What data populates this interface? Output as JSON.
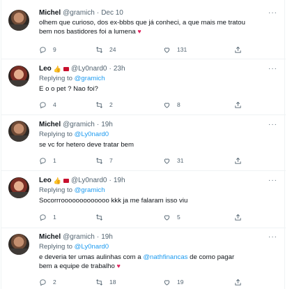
{
  "tweets": [
    {
      "author": "Michel",
      "handle": "@gramich",
      "time": "Dec 10",
      "reply_prefix": "",
      "reply_to": "",
      "text_html_parts": [
        {
          "t": "olhem que curioso, dos ex-bbbs que já conheci, a que mais me tratou bem nos bastidores foi a lumena ",
          "c": "normal"
        },
        {
          "t": "♥",
          "c": "heart"
        }
      ],
      "replies": "9",
      "retweets": "24",
      "likes": "131"
    },
    {
      "author": "Leo",
      "handle": "@Ly0nard0",
      "time": "23h",
      "reply_prefix": "Replying to ",
      "reply_to": "@gramich",
      "text_html_parts": [
        {
          "t": "E o o pet ? Nao foi?",
          "c": "normal"
        }
      ],
      "replies": "4",
      "retweets": "2",
      "likes": "8"
    },
    {
      "author": "Michel",
      "handle": "@gramich",
      "time": "19h",
      "reply_prefix": "Replying to ",
      "reply_to": "@Ly0nard0",
      "text_html_parts": [
        {
          "t": "se vc for hetero deve tratar bem",
          "c": "normal"
        }
      ],
      "replies": "1",
      "retweets": "7",
      "likes": "31"
    },
    {
      "author": "Leo",
      "handle": "@Ly0nard0",
      "time": "19h",
      "reply_prefix": "Replying to ",
      "reply_to": "@gramich",
      "text_html_parts": [
        {
          "t": "Socorrrooooooooooooo kkk ja me falaram isso viu",
          "c": "normal"
        }
      ],
      "replies": "1",
      "retweets": "",
      "likes": "5"
    },
    {
      "author": "Michel",
      "handle": "@gramich",
      "time": "19h",
      "reply_prefix": "Replying to ",
      "reply_to": "@Ly0nard0",
      "text_html_parts": [
        {
          "t": "e deveria ter umas aulinhas com a ",
          "c": "normal"
        },
        {
          "t": "@nathfinancas",
          "c": "mention"
        },
        {
          "t": " de como pagar bem a equipe de trabalho ",
          "c": "normal"
        },
        {
          "t": "♥",
          "c": "heart"
        }
      ],
      "replies": "2",
      "retweets": "18",
      "likes": "19"
    }
  ],
  "colors": {
    "link": "#1d9bf0",
    "secondary": "#536471",
    "heart": "#e0245e",
    "divider": "#eff3f4"
  },
  "icons": {
    "reply": "reply-icon",
    "retweet": "retweet-icon",
    "like": "like-icon",
    "share": "share-icon",
    "more": "more-icon"
  }
}
